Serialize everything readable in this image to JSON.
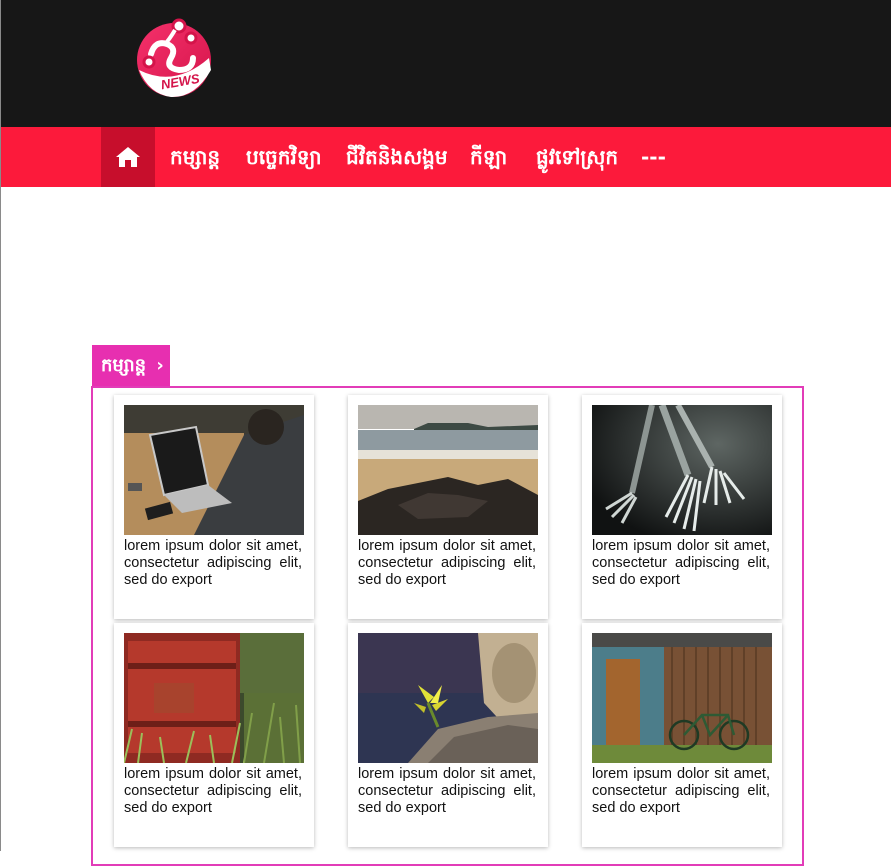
{
  "header": {
    "logo_text": "NEWS",
    "colors": {
      "topbar": "#171717",
      "nav": "#fc1a3b",
      "nav_active": "#c70e2c",
      "accent": "#e72fb0"
    }
  },
  "nav": {
    "home_icon": "home-icon",
    "items": [
      {
        "label": "កម្សាន្ត"
      },
      {
        "label": "បច្ចេកវិទ្យា"
      },
      {
        "label": "ជីវិតនិងសង្គម"
      },
      {
        "label": "កីឡា"
      },
      {
        "label": "ផ្លូវទៅស្រុក"
      },
      {
        "label": "---"
      }
    ]
  },
  "section": {
    "title": "កម្សាន្ត",
    "chevron": "›",
    "cards": [
      {
        "image": "laptop-photo",
        "caption": "lorem ipsum dolor sit amet, consectetur adipiscing elit, sed do export"
      },
      {
        "image": "beach-photo",
        "caption": "lorem ipsum dolor sit amet, consectetur adipiscing elit, sed do export"
      },
      {
        "image": "forks-photo",
        "caption": "lorem ipsum dolor sit amet, consectetur adipiscing elit, sed do export"
      },
      {
        "image": "rusty-barrel-photo",
        "caption": "lorem ipsum dolor sit amet, consectetur adipiscing elit, sed do export"
      },
      {
        "image": "flower-on-wood-photo",
        "caption": "lorem ipsum dolor sit amet, consectetur adipiscing elit, sed do export"
      },
      {
        "image": "wooden-shed-bicycle-photo",
        "caption": "lorem ipsum dolor sit amet, consectetur adipiscing elit, sed do export"
      }
    ]
  }
}
